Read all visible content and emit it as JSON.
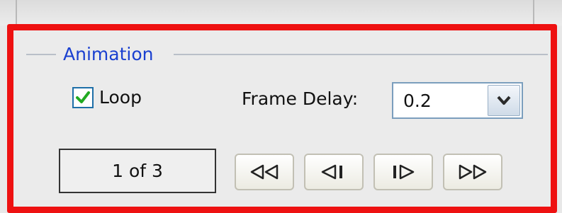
{
  "animation": {
    "group_label": "Animation",
    "loop": {
      "label": "Loop",
      "checked": true
    },
    "frame_delay": {
      "label": "Frame Delay:",
      "value": "0.2"
    },
    "frame_counter": "1 of 3",
    "buttons": {
      "first": "first-frame-icon",
      "previous": "previous-frame-icon",
      "next": "next-frame-icon",
      "last": "last-frame-icon"
    }
  },
  "colors": {
    "highlight_border": "#ee1111",
    "legend_text": "#1a40d0",
    "checkmark": "#22aa22"
  }
}
